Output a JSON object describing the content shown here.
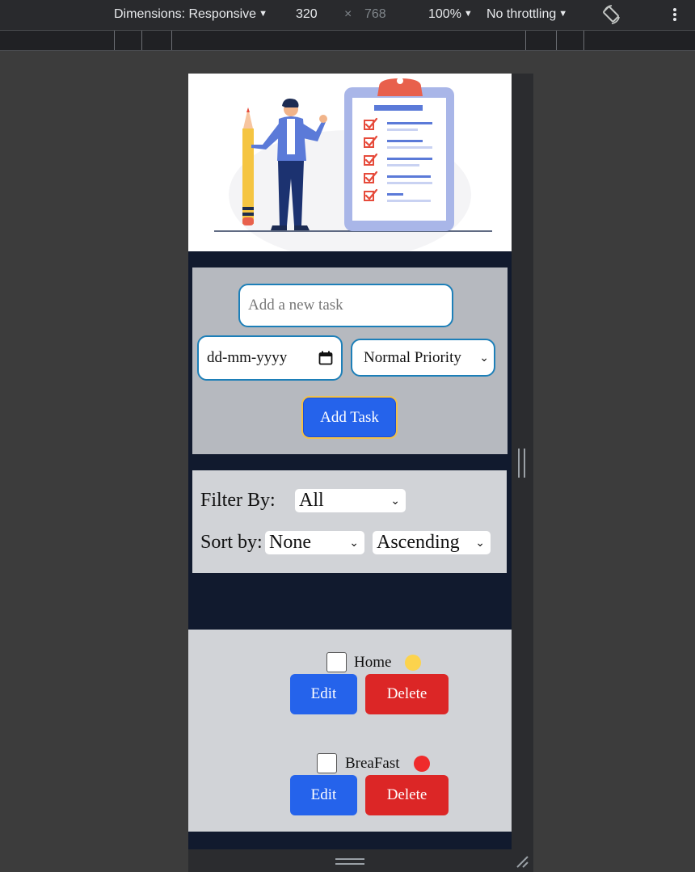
{
  "devtools": {
    "dimensions_label": "Dimensions: Responsive",
    "width": "320",
    "times": "×",
    "height": "768",
    "zoom": "100%",
    "throttling": "No throttling"
  },
  "app": {
    "new_task_placeholder": "Add a new task",
    "date_placeholder": "dd-mm-yyyy",
    "priority_selected": "Normal Priority",
    "add_button": "Add Task",
    "filter_label": "Filter By:",
    "filter_selected": "All",
    "sort_label": "Sort by:",
    "sort_selected": "None",
    "order_selected": "Ascending"
  },
  "tasks": [
    {
      "name": "Home",
      "priority_color": "#fcd34d",
      "edit": "Edit",
      "delete": "Delete",
      "completed": false
    },
    {
      "name": "BreaFast",
      "priority_color": "#ef2b2b",
      "edit": "Edit",
      "delete": "Delete",
      "completed": false
    }
  ],
  "colors": {
    "accent_blue": "#2563eb",
    "danger_red": "#dc2626",
    "page_bg": "#111a2e"
  }
}
